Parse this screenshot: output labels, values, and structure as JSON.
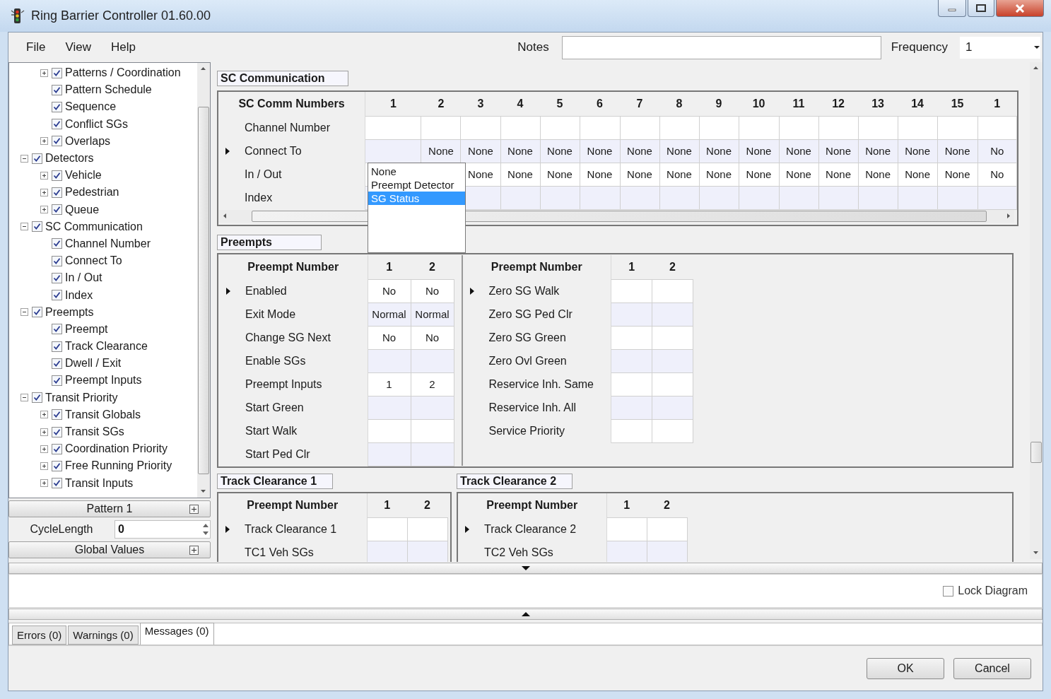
{
  "window": {
    "title": "Ring Barrier Controller 01.60.00"
  },
  "menu": [
    "File",
    "View",
    "Help"
  ],
  "notes": {
    "label": "Notes"
  },
  "frequency": {
    "label": "Frequency",
    "value": "1"
  },
  "tree": {
    "items": [
      {
        "children": [
          {
            "label": "Patterns / Coordination",
            "checked": true,
            "expanded": false
          },
          {
            "label": "Pattern Schedule",
            "checked": true
          },
          {
            "label": "Sequence",
            "checked": true
          },
          {
            "label": "Conflict SGs",
            "checked": true
          },
          {
            "label": "Overlaps",
            "checked": true,
            "expanded": false
          }
        ]
      },
      {
        "label": "Detectors",
        "checked": true,
        "expanded": true,
        "children": [
          {
            "label": "Vehicle",
            "checked": true,
            "expanded": false
          },
          {
            "label": "Pedestrian",
            "checked": true,
            "expanded": false
          },
          {
            "label": "Queue",
            "checked": true,
            "expanded": false
          }
        ]
      },
      {
        "label": "SC Communication",
        "checked": true,
        "expanded": true,
        "children": [
          {
            "label": "Channel Number",
            "checked": true
          },
          {
            "label": "Connect To",
            "checked": true
          },
          {
            "label": "In / Out",
            "checked": true
          },
          {
            "label": "Index",
            "checked": true
          }
        ]
      },
      {
        "label": "Preempts",
        "checked": true,
        "expanded": true,
        "children": [
          {
            "label": "Preempt",
            "checked": true
          },
          {
            "label": "Track Clearance",
            "checked": true
          },
          {
            "label": "Dwell / Exit",
            "checked": true
          },
          {
            "label": "Preempt Inputs",
            "checked": true
          }
        ]
      },
      {
        "label": "Transit Priority",
        "checked": true,
        "expanded": true,
        "children": [
          {
            "label": "Transit Globals",
            "checked": true,
            "expanded": false
          },
          {
            "label": "Transit SGs",
            "checked": true,
            "expanded": false
          },
          {
            "label": "Coordination Priority",
            "checked": true,
            "expanded": false
          },
          {
            "label": "Free Running Priority",
            "checked": true,
            "expanded": false
          },
          {
            "label": "Transit Inputs",
            "checked": true,
            "expanded": false
          }
        ]
      }
    ]
  },
  "left_controls": {
    "pattern": "Pattern 1",
    "cycle_length": {
      "label": "CycleLength",
      "value": "0"
    },
    "global_values": "Global Values"
  },
  "sc_communication": {
    "title": "SC Communication",
    "grid": {
      "header": "SC Comm Numbers",
      "columns": [
        "1",
        "2",
        "3",
        "4",
        "5",
        "6",
        "7",
        "8",
        "9",
        "10",
        "11",
        "12",
        "13",
        "14",
        "15",
        "1"
      ],
      "rows": [
        {
          "label": "Channel Number",
          "current": false,
          "cells": [
            null,
            null,
            null,
            null,
            null,
            null,
            null,
            null,
            null,
            null,
            null,
            null,
            null,
            null,
            null,
            null
          ]
        },
        {
          "label": "Connect To",
          "current": true,
          "cells": [
            null,
            "None",
            "None",
            "None",
            "None",
            "None",
            "None",
            "None",
            "None",
            "None",
            "None",
            "None",
            "None",
            "None",
            "None",
            "No"
          ],
          "dropdown": {
            "options": [
              {
                "label": "None",
                "selected": false
              },
              {
                "label": "Preempt Detector",
                "selected": false
              },
              {
                "label": "SG Status",
                "selected": true
              }
            ]
          }
        },
        {
          "label": "In / Out",
          "current": false,
          "cells": [
            null,
            null,
            "None",
            "None",
            "None",
            "None",
            "None",
            "None",
            "None",
            "None",
            "None",
            "None",
            "None",
            "None",
            "None",
            "No"
          ]
        },
        {
          "label": "Index",
          "current": false,
          "cells": [
            null,
            null,
            null,
            null,
            null,
            null,
            null,
            null,
            null,
            null,
            null,
            null,
            null,
            null,
            null,
            null
          ]
        }
      ]
    }
  },
  "preempts": {
    "title": "Preempts",
    "grids": [
      {
        "header": "Preempt Number",
        "columns": [
          "1",
          "2"
        ],
        "rows": [
          {
            "label": "Enabled",
            "current": true,
            "cells": [
              "No",
              "No"
            ]
          },
          {
            "label": "Exit Mode",
            "current": false,
            "cells": [
              "Normal",
              "Normal"
            ]
          },
          {
            "label": "Change SG Next",
            "current": false,
            "cells": [
              "No",
              "No"
            ]
          },
          {
            "label": "Enable SGs",
            "current": false,
            "cells": [
              null,
              null
            ]
          },
          {
            "label": "Preempt Inputs",
            "current": false,
            "cells": [
              "1",
              "2"
            ]
          },
          {
            "label": "Start Green",
            "current": false,
            "cells": [
              null,
              null
            ]
          },
          {
            "label": "Start Walk",
            "current": false,
            "cells": [
              null,
              null
            ]
          },
          {
            "label": "Start Ped Clr",
            "current": false,
            "cells": [
              null,
              null
            ]
          }
        ]
      },
      {
        "header": "Preempt Number",
        "columns": [
          "1",
          "2"
        ],
        "rows": [
          {
            "label": "Zero SG Walk",
            "current": true,
            "cells": [
              null,
              null
            ]
          },
          {
            "label": "Zero SG Ped Clr",
            "current": false,
            "cells": [
              null,
              null
            ]
          },
          {
            "label": "Zero SG Green",
            "current": false,
            "cells": [
              null,
              null
            ]
          },
          {
            "label": "Zero Ovl Green",
            "current": false,
            "cells": [
              null,
              null
            ]
          },
          {
            "label": "Reservice Inh. Same",
            "current": false,
            "cells": [
              null,
              null
            ]
          },
          {
            "label": "Reservice Inh. All",
            "current": false,
            "cells": [
              null,
              null
            ]
          },
          {
            "label": "Service Priority",
            "current": false,
            "cells": [
              null,
              null
            ]
          }
        ]
      }
    ]
  },
  "track_clearance": [
    {
      "title": "Track Clearance 1",
      "grid": {
        "header": "Preempt Number",
        "columns": [
          "1",
          "2"
        ],
        "rows": [
          {
            "label": "Track Clearance 1",
            "current": true,
            "cells": [
              null,
              null
            ]
          },
          {
            "label": "TC1 Veh SGs",
            "current": false,
            "cells": [
              null,
              null
            ]
          }
        ]
      }
    },
    {
      "title": "Track Clearance 2",
      "grid": {
        "header": "Preempt Number",
        "columns": [
          "1",
          "2"
        ],
        "rows": [
          {
            "label": "Track Clearance 2",
            "current": true,
            "cells": [
              null,
              null
            ]
          },
          {
            "label": "TC2 Veh SGs",
            "current": false,
            "cells": [
              null,
              null
            ]
          }
        ]
      }
    }
  ],
  "diagram": {
    "lock_diagram": {
      "label": "Lock Diagram",
      "checked": false
    }
  },
  "message_tabs": [
    {
      "label": "Errors (0)",
      "selected": false
    },
    {
      "label": "Warnings (0)",
      "selected": false
    },
    {
      "label": "Messages (0)",
      "selected": true
    }
  ],
  "buttons": [
    "OK",
    "Cancel"
  ]
}
